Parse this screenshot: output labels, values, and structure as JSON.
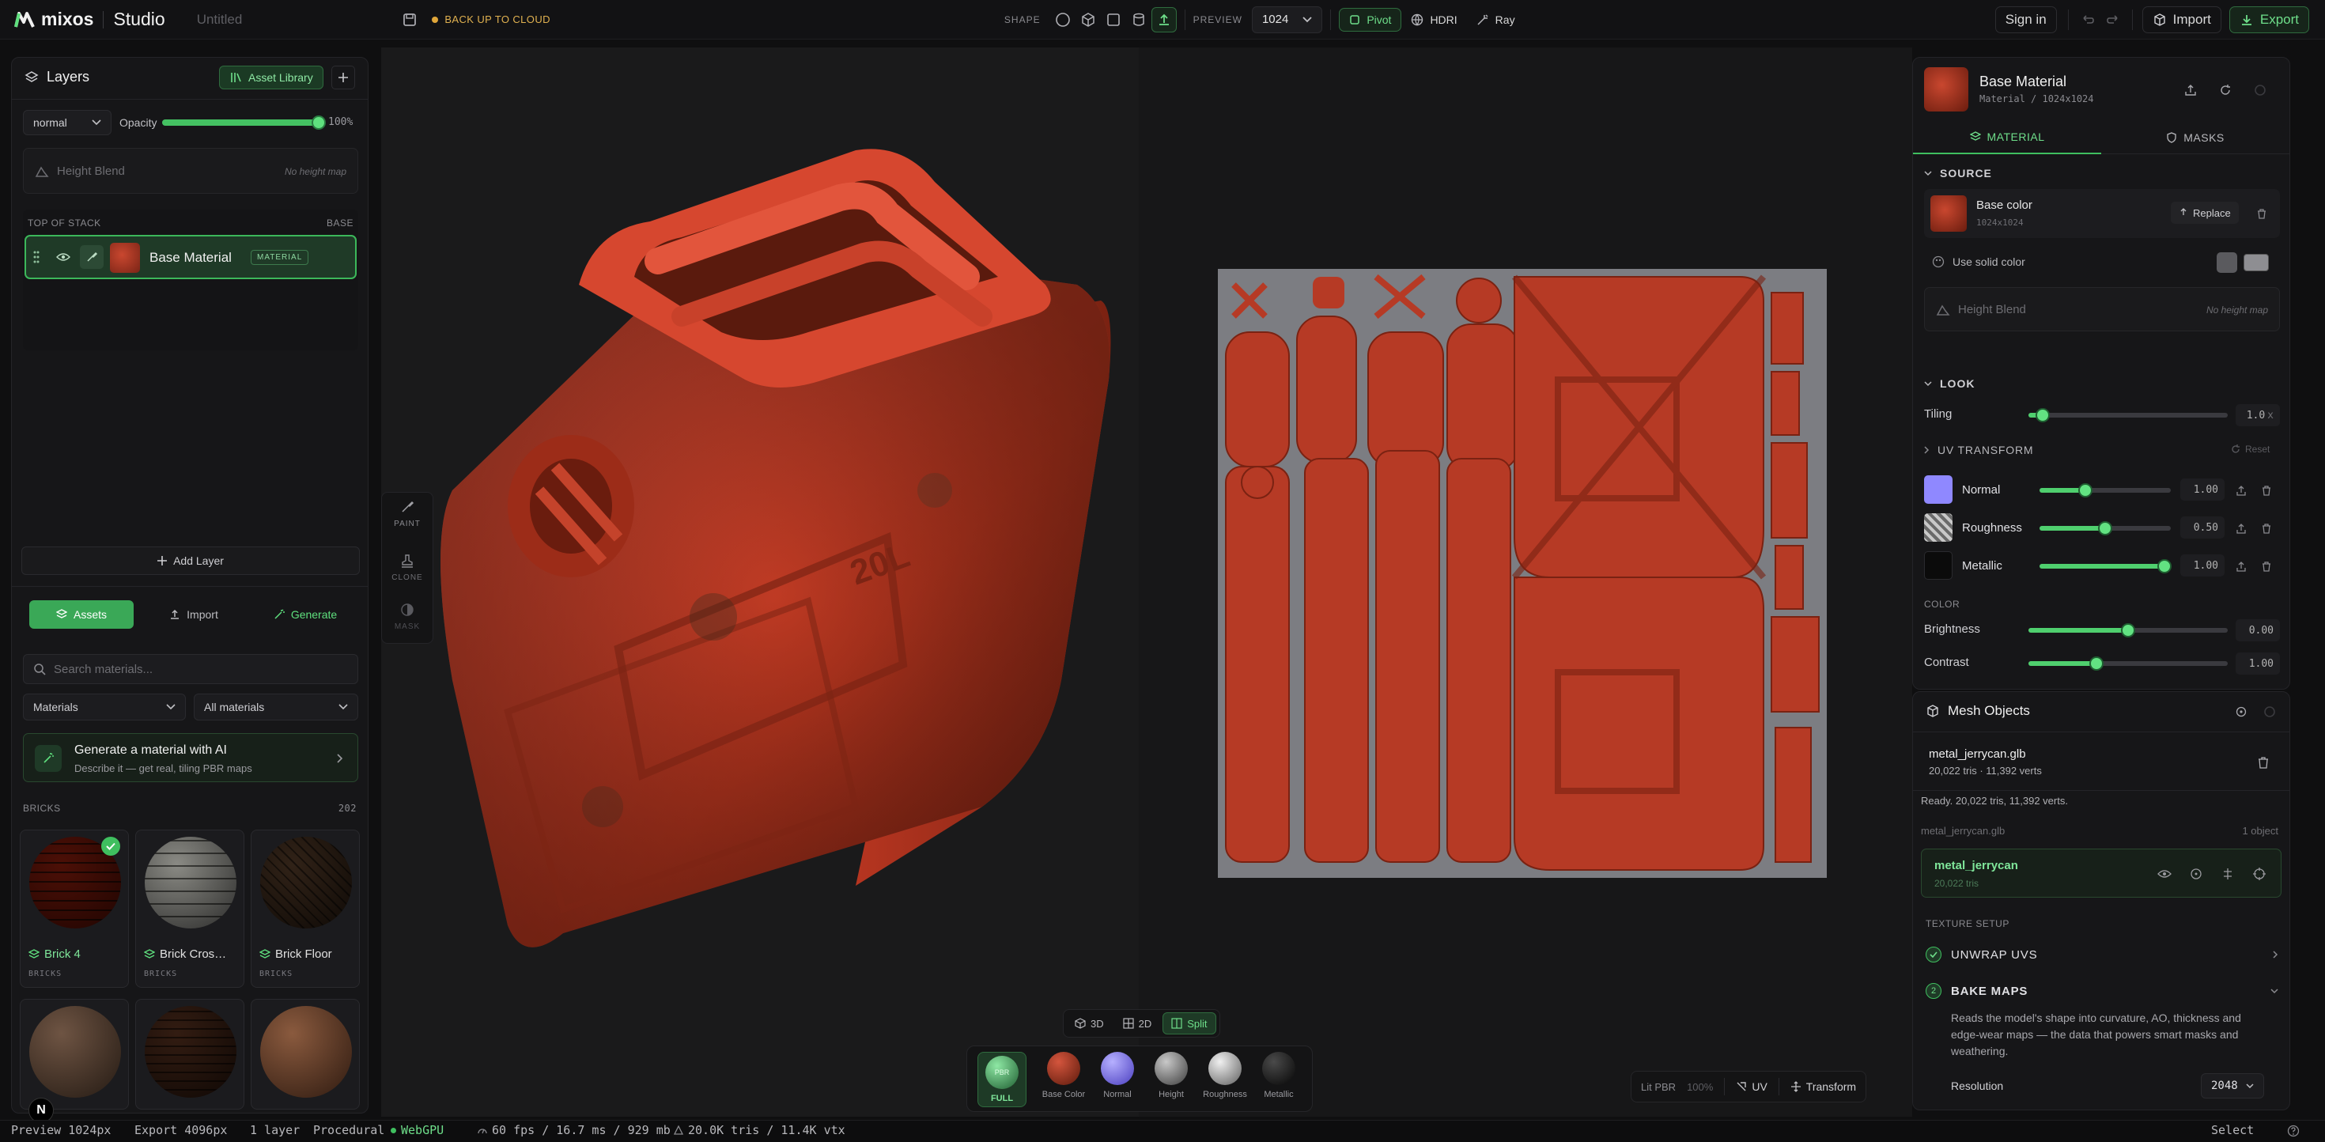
{
  "app": {
    "brand": "mixos",
    "product": "Studio",
    "doc_title": "Untitled"
  },
  "topbar": {
    "cloud_backup": "BACK UP TO CLOUD",
    "shape_label": "SHAPE",
    "preview_label": "PREVIEW",
    "preview_value": "1024",
    "pivot": "Pivot",
    "hdri": "HDRI",
    "ray": "Ray",
    "sign_in": "Sign in",
    "import": "Import",
    "export": "Export"
  },
  "layers": {
    "title": "Layers",
    "asset_library": "Asset Library",
    "blend_mode": "normal",
    "opacity_label": "Opacity",
    "opacity_value": "100%",
    "opacity_fraction": 1.0,
    "height_blend": "Height Blend",
    "no_height_map": "No height map",
    "top_of_stack": "TOP OF STACK",
    "base": "BASE",
    "layer_name": "Base Material",
    "layer_tag": "MATERIAL",
    "add_layer": "Add Layer"
  },
  "assets": {
    "tabs": [
      "Assets",
      "Import",
      "Generate"
    ],
    "search_placeholder": "Search materials...",
    "filter_type": "Materials",
    "filter_scope": "All materials",
    "ai_title": "Generate a material with AI",
    "ai_sub": "Describe it — get real, tiling PBR maps",
    "category": "BRICKS",
    "count": "202",
    "items": [
      {
        "name": "Brick 4",
        "cat": "BRICKS",
        "selected": true
      },
      {
        "name": "Brick Cros…",
        "cat": "BRICKS",
        "selected": false
      },
      {
        "name": "Brick Floor",
        "cat": "BRICKS",
        "selected": false
      }
    ]
  },
  "tools": [
    {
      "name": "PAINT"
    },
    {
      "name": "CLONE"
    },
    {
      "name": "MASK"
    }
  ],
  "viewport": {
    "modes": [
      "3D",
      "2D",
      "Split"
    ],
    "active_mode": "Split",
    "channels": [
      "FULL",
      "Base Color",
      "Normal",
      "Height",
      "Roughness",
      "Metallic"
    ],
    "full_badge": "PBR",
    "lit_pbr": "Lit PBR",
    "lit_pct": "100%",
    "uv": "UV",
    "transform": "Transform",
    "can_text": "20L"
  },
  "material": {
    "title": "Base Material",
    "subtitle": "Material / 1024x1024",
    "tabs": [
      "MATERIAL",
      "MASKS"
    ],
    "source": "SOURCE",
    "base_color": "Base color",
    "base_color_size": "1024x1024",
    "replace": "Replace",
    "use_solid_color": "Use solid color",
    "height_blend": "Height Blend",
    "no_height_map": "No height map",
    "look": "LOOK",
    "tiling_label": "Tiling",
    "tiling_value": "1.0",
    "tiling_unit": "x",
    "tiling_fraction": 0.07,
    "uv_transform": "UV TRANSFORM",
    "reset": "Reset",
    "maps": [
      {
        "name": "Normal",
        "value": "1.00",
        "fraction": 0.35,
        "color": "#8f88ff"
      },
      {
        "name": "Roughness",
        "value": "0.50",
        "fraction": 0.5,
        "color": "#9a9a9a"
      },
      {
        "name": "Metallic",
        "value": "1.00",
        "fraction": 0.95,
        "color": "#0b0b0b"
      }
    ],
    "color_label": "COLOR",
    "brightness_label": "Brightness",
    "brightness_value": "0.00",
    "brightness_fraction": 0.5,
    "contrast_label": "Contrast",
    "contrast_value": "1.00",
    "contrast_fraction": 0.34
  },
  "mesh": {
    "title": "Mesh Objects",
    "file": "metal_jerrycan.glb",
    "file_stats": "20,022 tris · 11,392 verts",
    "ready": "Ready. 20,022 tris, 11,392 verts.",
    "group": "metal_jerrycan.glb",
    "group_count": "1 object",
    "object": "metal_jerrycan",
    "object_tris": "20,022 tris",
    "texture_setup": "TEXTURE SETUP",
    "unwrap": "UNWRAP UVS",
    "bake_num": "2",
    "bake": "BAKE MAPS",
    "bake_desc": "Reads the model's shape into curvature, AO, thickness and edge-wear maps — the data that powers smart masks and weathering.",
    "resolution_label": "Resolution",
    "resolution_value": "2048"
  },
  "statusbar": {
    "preview": "Preview 1024px",
    "export": "Export 4096px",
    "layers": "1 layer",
    "procedural": "Procedural",
    "webgpu": "WebGPU",
    "perf": "60 fps / 16.7 ms / 929 mb",
    "geo": "20.0K tris / 11.4K vtx",
    "select": "Select"
  },
  "colors": {
    "accent": "#3fbf5f",
    "rust": "#c9412d",
    "bg": "#0f0f10"
  }
}
